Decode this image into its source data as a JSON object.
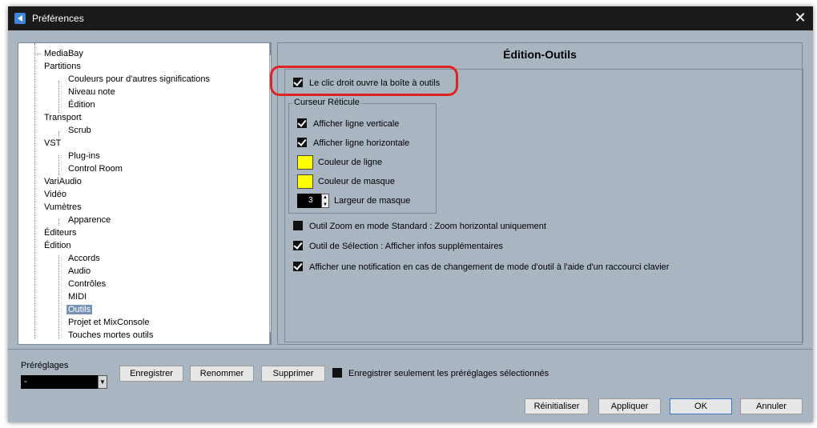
{
  "window": {
    "title": "Préférences"
  },
  "tree": {
    "items": [
      {
        "label": "MediaBay"
      },
      {
        "label": "Partitions"
      },
      {
        "label": "Couleurs pour d'autres significations"
      },
      {
        "label": "Niveau note"
      },
      {
        "label": "Édition"
      },
      {
        "label": "Transport"
      },
      {
        "label": "Scrub"
      },
      {
        "label": "VST"
      },
      {
        "label": "Plug-ins"
      },
      {
        "label": "Control Room"
      },
      {
        "label": "VariAudio"
      },
      {
        "label": "Vidéo"
      },
      {
        "label": "Vumètres"
      },
      {
        "label": "Apparence"
      },
      {
        "label": "Éditeurs"
      },
      {
        "label": "Édition"
      },
      {
        "label": "Accords"
      },
      {
        "label": "Audio"
      },
      {
        "label": "Contrôles"
      },
      {
        "label": "MIDI"
      },
      {
        "label": "Outils"
      },
      {
        "label": "Projet et MixConsole"
      },
      {
        "label": "Touches mortes outils"
      }
    ],
    "selected": "Outils"
  },
  "panel": {
    "title": "Édition-Outils",
    "right_click_toolbox": {
      "label": "Le clic droit ouvre la boîte à outils",
      "checked": true
    },
    "crosshair": {
      "group_label": "Curseur Réticule",
      "vertical_line": {
        "label": "Afficher ligne verticale",
        "checked": true
      },
      "horizontal_line": {
        "label": "Afficher ligne horizontale",
        "checked": true
      },
      "line_color": {
        "label": "Couleur de ligne",
        "color": "#ffff00"
      },
      "mask_color": {
        "label": "Couleur de masque",
        "color": "#ffff00"
      },
      "mask_width": {
        "label": "Largeur de masque",
        "value": "3"
      }
    },
    "zoom_tool": {
      "label": "Outil Zoom en mode Standard : Zoom horizontal uniquement",
      "checked": false
    },
    "selection_tool": {
      "label": "Outil de Sélection : Afficher infos supplémentaires",
      "checked": true
    },
    "notify_tool_change": {
      "label": "Afficher une notification en cas de changement de mode d'outil à l'aide d'un raccourci clavier",
      "checked": true
    }
  },
  "presets": {
    "label": "Préréglages",
    "value": "-",
    "save": "Enregistrer",
    "rename": "Renommer",
    "delete": "Supprimer",
    "save_selected_only": {
      "label": "Enregistrer seulement les préréglages sélectionnés",
      "checked": false
    }
  },
  "footer": {
    "reset": "Réinitialiser",
    "apply": "Appliquer",
    "ok": "OK",
    "cancel": "Annuler"
  },
  "colors": {
    "highlight_ring": "#e02222",
    "selection": "#7693b5"
  }
}
